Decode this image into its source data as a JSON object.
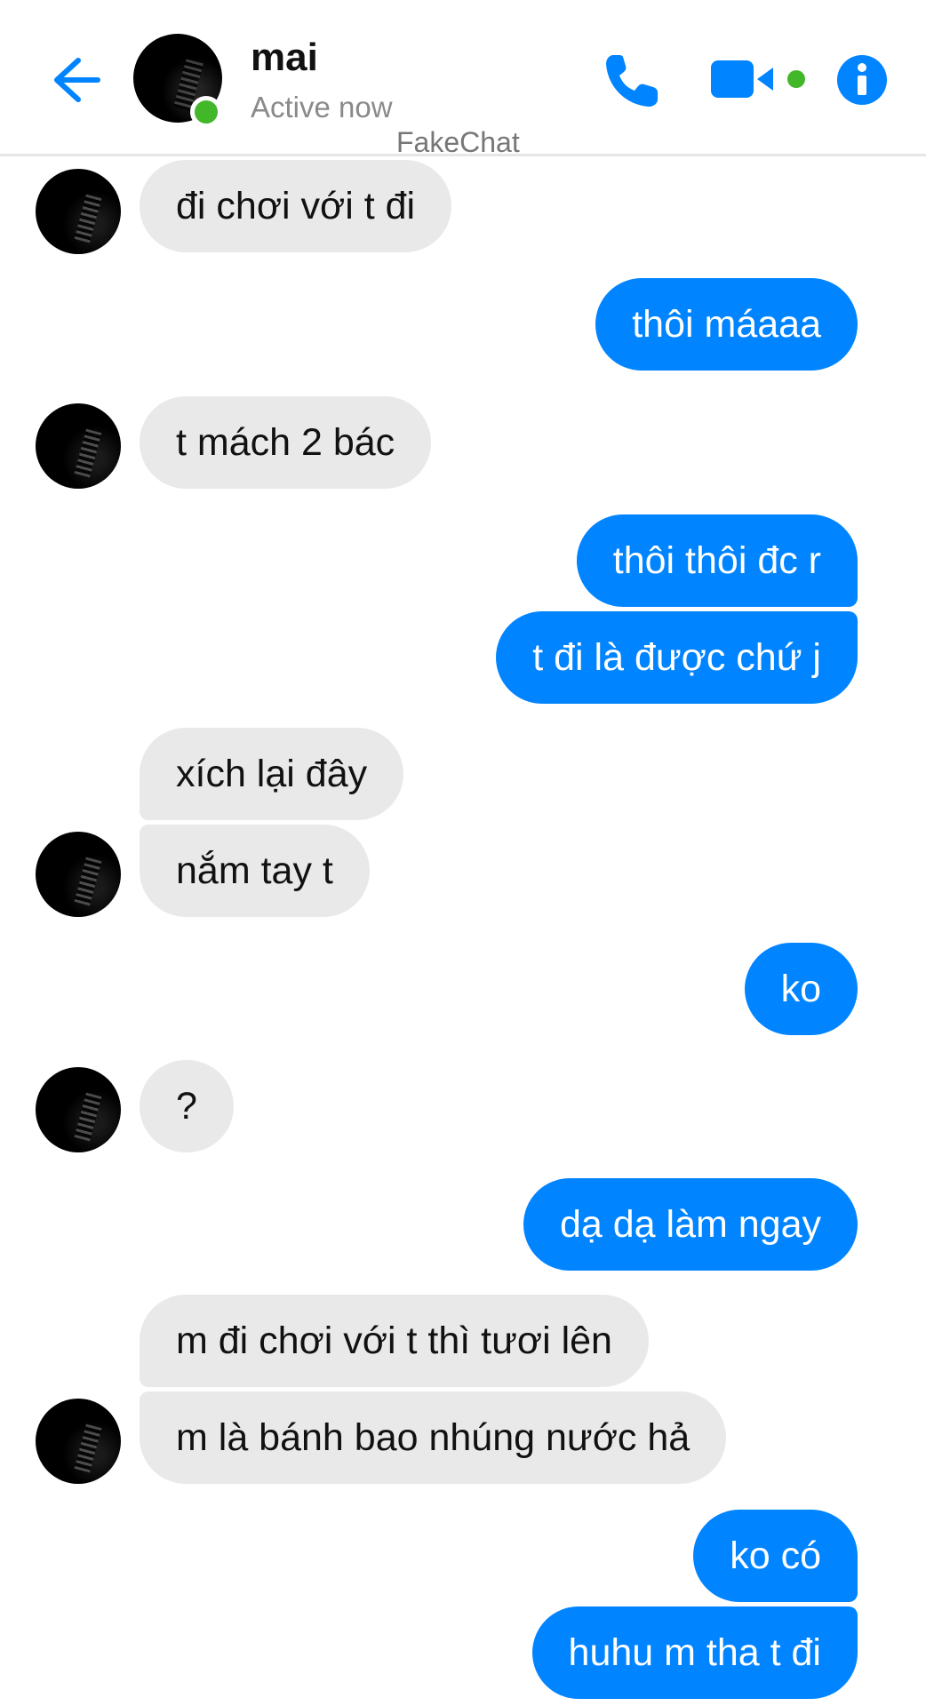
{
  "header": {
    "contact_name": "mai",
    "status": "Active now",
    "watermark": "FakeChat",
    "icons": {
      "back": "arrow-left-icon",
      "call": "phone-icon",
      "video": "video-camera-icon",
      "info": "info-icon"
    },
    "colors": {
      "accent": "#0084ff",
      "online": "#42b72a"
    }
  },
  "messages": [
    {
      "side": "in",
      "text": "đi chơi với t đi"
    },
    {
      "side": "out",
      "text": "thôi máaaa"
    },
    {
      "side": "in",
      "text": "t mách 2 bác"
    },
    {
      "side": "out",
      "text": "thôi thôi đc r"
    },
    {
      "side": "out",
      "text": "t đi là được chứ j"
    },
    {
      "side": "in",
      "text": "xích lại đây"
    },
    {
      "side": "in",
      "text": "nắm tay t"
    },
    {
      "side": "out",
      "text": "ko"
    },
    {
      "side": "in",
      "text": "?"
    },
    {
      "side": "out",
      "text": "dạ dạ làm ngay"
    },
    {
      "side": "in",
      "text": "m đi chơi với t thì tươi lên"
    },
    {
      "side": "in",
      "text": "m là bánh bao nhúng nước hả"
    },
    {
      "side": "out",
      "text": "ko có"
    },
    {
      "side": "out",
      "text": "huhu m tha t đi"
    }
  ],
  "colors": {
    "incoming_bubble": "#e9e9e9",
    "outgoing_bubble": "#0084ff"
  }
}
